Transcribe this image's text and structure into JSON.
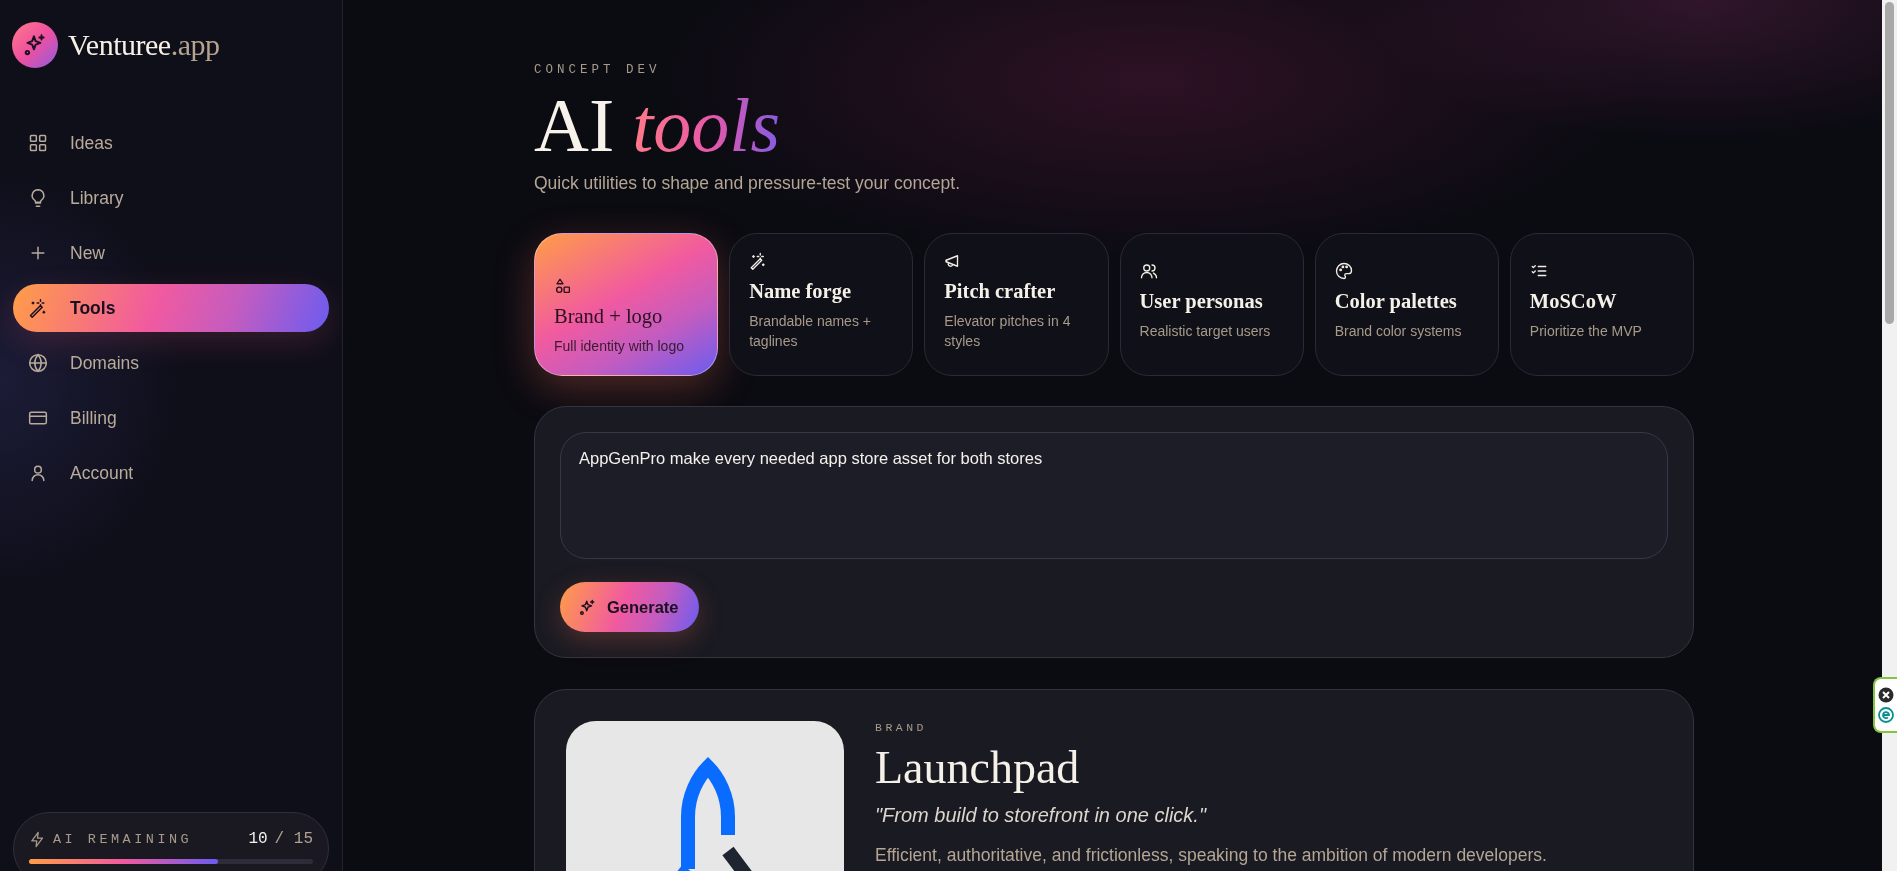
{
  "sidebar": {
    "brand": {
      "name": "Venturee",
      "suffix": ".app"
    },
    "nav": [
      {
        "label": "Ideas",
        "selected": false
      },
      {
        "label": "Library",
        "selected": false
      },
      {
        "label": "New",
        "selected": false
      },
      {
        "label": "Tools",
        "selected": true
      },
      {
        "label": "Domains",
        "selected": false
      },
      {
        "label": "Billing",
        "selected": false
      },
      {
        "label": "Account",
        "selected": false
      }
    ],
    "usage": {
      "label": "AI REMAINING",
      "used": "10",
      "total": "/ 15",
      "level": 0.667
    }
  },
  "header": {
    "eyebrow": "CONCEPT DEV",
    "title": "AI",
    "title_accent": "tools",
    "subtitle": "Quick utilities to shape and pressure-test your concept."
  },
  "tools": [
    {
      "title": "Brand + logo",
      "description": "Full identity with logo",
      "selected": true
    },
    {
      "title": "Name forge",
      "description": "Brandable names + taglines",
      "selected": false
    },
    {
      "title": "Pitch crafter",
      "description": "Elevator pitches in 4 styles",
      "selected": false
    },
    {
      "title": "User personas",
      "description": "Realistic target users",
      "selected": false
    },
    {
      "title": "Color palettes",
      "description": "Brand color systems",
      "selected": false
    },
    {
      "title": "MoSCoW",
      "description": "Prioritize the MVP",
      "selected": false
    }
  ],
  "prompt": {
    "value": "AppGenPro make every needed app store asset for both stores",
    "button": "Generate"
  },
  "result": {
    "eyebrow": "BRAND",
    "name": "Launchpad",
    "tagline": "\"From build to storefront in one click.\"",
    "description": "Efficient, authoritative, and frictionless, speaking to the ambition of modern developers."
  }
}
